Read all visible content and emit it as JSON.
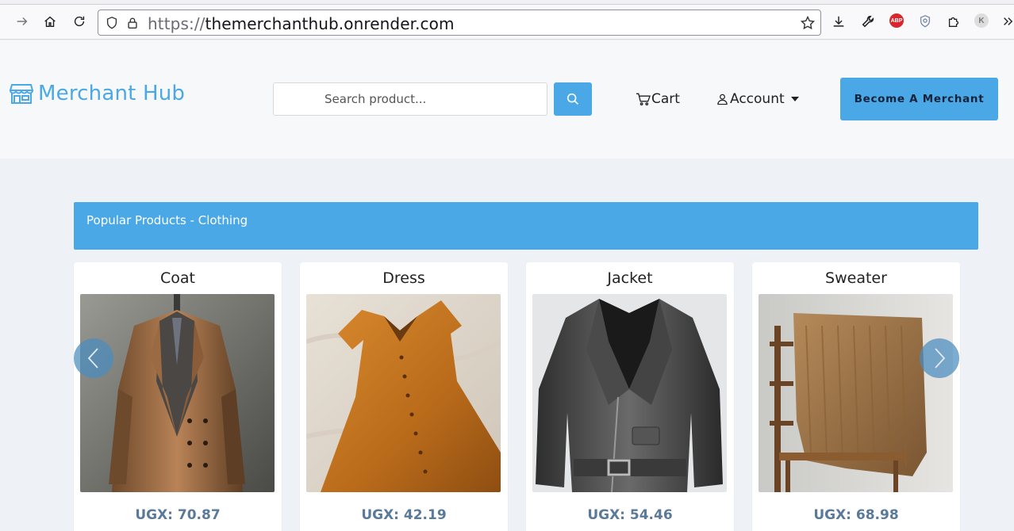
{
  "browser": {
    "url_scheme": "https://",
    "url_host": "themerchanthub.onrender.com",
    "abp_label": "ABP",
    "profile_initial": "K"
  },
  "header": {
    "brand_name": "Merchant Hub",
    "search_placeholder": "Search product...",
    "cart_label": "Cart",
    "account_label": "Account",
    "merchant_button": "Become A Merchant"
  },
  "section": {
    "title": "Popular Products - Clothing"
  },
  "products": [
    {
      "name": "Coat",
      "price": "UGX: 70.87"
    },
    {
      "name": "Dress",
      "price": "UGX: 42.19"
    },
    {
      "name": "Jacket",
      "price": "UGX: 54.46"
    },
    {
      "name": "Sweater",
      "price": "UGX: 68.98"
    }
  ],
  "colors": {
    "accent": "#4aa8e6",
    "price_text": "#5a7a9a",
    "page_bg": "#eef2f6"
  }
}
